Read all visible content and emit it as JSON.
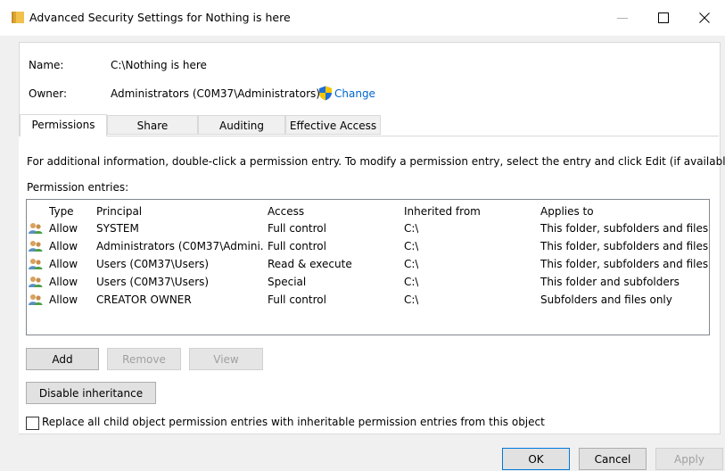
{
  "window": {
    "title": "Advanced Security Settings for Nothing is here",
    "minimize_icon": "minimize-icon",
    "maximize_icon": "maximize-icon",
    "close_icon": "close-icon"
  },
  "header": {
    "name_label": "Name:",
    "name_value": "C:\\Nothing is here",
    "owner_label": "Owner:",
    "owner_value": "Administrators (C0M37\\Administrators)",
    "change_link": "Change"
  },
  "tabs": [
    {
      "label": "Permissions"
    },
    {
      "label": "Share"
    },
    {
      "label": "Auditing"
    },
    {
      "label": "Effective Access"
    }
  ],
  "permissions": {
    "info_text": "For additional information, double-click a permission entry. To modify a permission entry, select the entry and click Edit (if available).",
    "entries_label": "Permission entries:",
    "columns": {
      "type": "Type",
      "principal": "Principal",
      "access": "Access",
      "inherited": "Inherited from",
      "applies": "Applies to"
    },
    "rows": [
      {
        "type": "Allow",
        "principal": "SYSTEM",
        "access": "Full control",
        "inherited": "C:\\",
        "applies": "This folder, subfolders and files"
      },
      {
        "type": "Allow",
        "principal": "Administrators (C0M37\\Admini...",
        "access": "Full control",
        "inherited": "C:\\",
        "applies": "This folder, subfolders and files"
      },
      {
        "type": "Allow",
        "principal": "Users (C0M37\\Users)",
        "access": "Read & execute",
        "inherited": "C:\\",
        "applies": "This folder, subfolders and files"
      },
      {
        "type": "Allow",
        "principal": "Users (C0M37\\Users)",
        "access": "Special",
        "inherited": "C:\\",
        "applies": "This folder and subfolders"
      },
      {
        "type": "Allow",
        "principal": "CREATOR OWNER",
        "access": "Full control",
        "inherited": "C:\\",
        "applies": "Subfolders and files only"
      }
    ],
    "buttons": {
      "add": "Add",
      "remove": "Remove",
      "view": "View",
      "disable_inheritance": "Disable inheritance"
    },
    "replace_checkbox_label": "Replace all child object permission entries with inheritable permission entries from this object",
    "replace_checked": false
  },
  "footer": {
    "ok": "OK",
    "cancel": "Cancel",
    "apply": "Apply"
  },
  "colors": {
    "link": "#0066cc",
    "shield_blue": "#1e6fd9",
    "shield_yellow": "#f6c700",
    "folder_yellow": "#e8b33c"
  }
}
